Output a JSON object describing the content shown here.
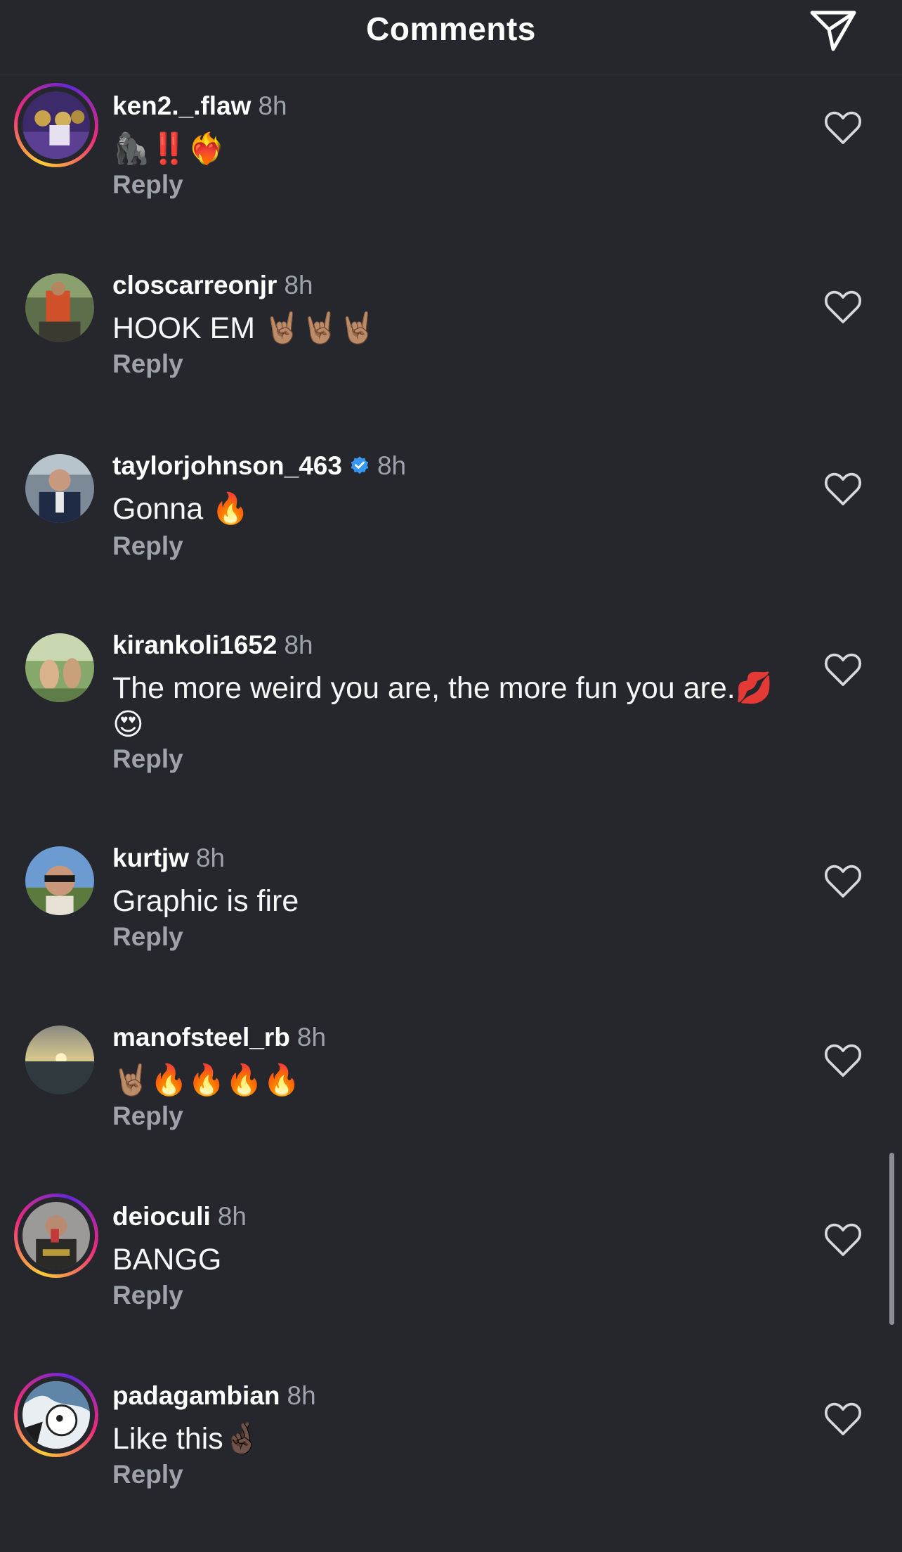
{
  "header": {
    "title": "Comments",
    "send_icon": "paper-plane-icon"
  },
  "colors": {
    "background": "#25272c",
    "text": "#ffffff",
    "muted": "#9ea3ab",
    "verified": "#3897f0"
  },
  "comments": [
    {
      "username": "ken2._.flaw",
      "time": "8h",
      "text": "🦍‼️❤️‍🔥",
      "reply": "Reply",
      "verified": false,
      "story_ring": true
    },
    {
      "username": "closcarreonjr",
      "time": "8h",
      "text": "HOOK EM 🤘🏽🤘🏽🤘🏽",
      "reply": "Reply",
      "verified": false,
      "story_ring": false
    },
    {
      "username": "taylorjohnson_463",
      "time": "8h",
      "text": "Gonna 🔥",
      "reply": "Reply",
      "verified": true,
      "story_ring": false
    },
    {
      "username": "kirankoli1652",
      "time": "8h",
      "text": "The more weird you are, the more fun you are.💋😍",
      "reply": "Reply",
      "verified": false,
      "story_ring": false
    },
    {
      "username": "kurtjw",
      "time": "8h",
      "text": "Graphic is fire",
      "reply": "Reply",
      "verified": false,
      "story_ring": false
    },
    {
      "username": "manofsteel_rb",
      "time": "8h",
      "text": "🤘🏽🔥🔥🔥🔥",
      "reply": "Reply",
      "verified": false,
      "story_ring": false
    },
    {
      "username": "deioculi",
      "time": "8h",
      "text": "BANGG",
      "reply": "Reply",
      "verified": false,
      "story_ring": true
    },
    {
      "username": "padagambian",
      "time": "8h",
      "text": "Like this🤞🏿",
      "reply": "Reply",
      "verified": false,
      "story_ring": true
    }
  ]
}
